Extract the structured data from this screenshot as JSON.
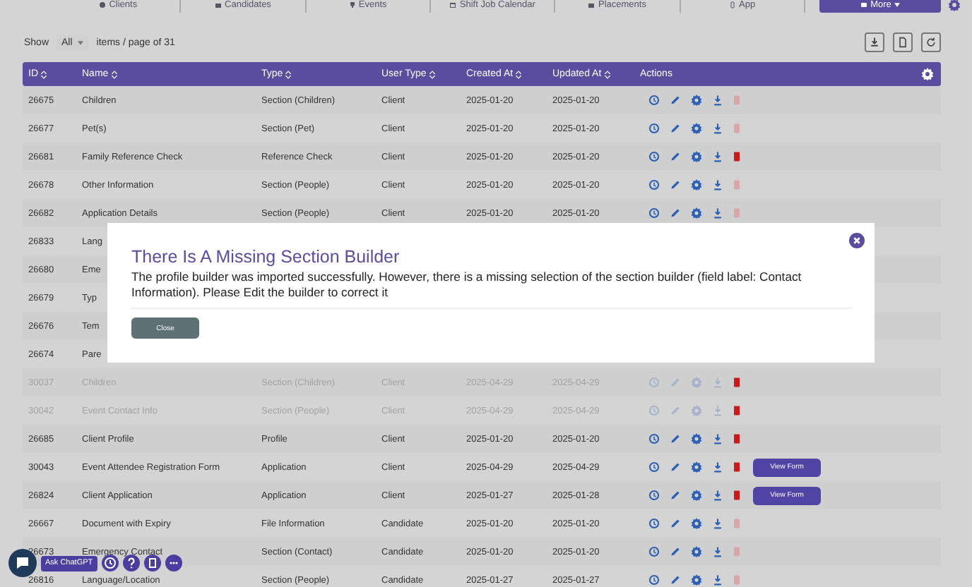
{
  "nav": {
    "tabs": [
      {
        "label": "Clients",
        "selected": false
      },
      {
        "label": "Candidates",
        "selected": false
      },
      {
        "label": "Events",
        "selected": false
      },
      {
        "label": "Shift Job Calendar",
        "selected": false
      },
      {
        "label": "Placements",
        "selected": false
      },
      {
        "label": "App",
        "selected": false
      },
      {
        "label": "More",
        "selected": true
      }
    ]
  },
  "toolbar": {
    "show_label": "Show",
    "page_size": "All",
    "pages_text": "items / page of 31"
  },
  "table": {
    "columns": [
      {
        "label": "ID",
        "sortable": true
      },
      {
        "label": "Name",
        "sortable": true
      },
      {
        "label": "Type",
        "sortable": true
      },
      {
        "label": "User Type",
        "sortable": true
      },
      {
        "label": "Created At",
        "sortable": true
      },
      {
        "label": "Updated At",
        "sortable": true
      },
      {
        "label": "Actions",
        "sortable": false
      }
    ],
    "rows": [
      {
        "id": "26675",
        "name": "Children",
        "type": "Section (Children)",
        "user_type": "Client",
        "created_at": "2025-01-20",
        "updated_at": "2025-01-20",
        "disabled": false,
        "delete_enabled": false
      },
      {
        "id": "26677",
        "name": "Pet(s)",
        "type": "Section (Pet)",
        "user_type": "Client",
        "created_at": "2025-01-20",
        "updated_at": "2025-01-20",
        "disabled": false,
        "delete_enabled": false
      },
      {
        "id": "26681",
        "name": "Family Reference Check",
        "type": "Reference Check",
        "user_type": "Client",
        "created_at": "2025-01-20",
        "updated_at": "2025-01-20",
        "disabled": false,
        "delete_enabled": true
      },
      {
        "id": "26678",
        "name": "Other Information",
        "type": "Section (People)",
        "user_type": "Client",
        "created_at": "2025-01-20",
        "updated_at": "2025-01-20",
        "disabled": false,
        "delete_enabled": false
      },
      {
        "id": "26682",
        "name": "Application Details",
        "type": "Section (People)",
        "user_type": "Client",
        "created_at": "2025-01-20",
        "updated_at": "2025-01-20",
        "disabled": false,
        "delete_enabled": false
      },
      {
        "id": "26833",
        "name": "Lang"
      },
      {
        "id": "26680",
        "name": "Eme"
      },
      {
        "id": "26679",
        "name": "Typ"
      },
      {
        "id": "26676",
        "name": "Tem"
      },
      {
        "id": "26674",
        "name": "Pare"
      },
      {
        "id": "30037",
        "name": "Children",
        "type": "Section (Children)",
        "user_type": "Client",
        "created_at": "2025-04-29",
        "updated_at": "2025-04-29",
        "disabled": true,
        "delete_enabled": true
      },
      {
        "id": "30042",
        "name": "Event Contact Info",
        "type": "Section (People)",
        "user_type": "Client",
        "created_at": "2025-04-29",
        "updated_at": "2025-04-29",
        "disabled": true,
        "delete_enabled": true
      },
      {
        "id": "26685",
        "name": "Client Profile",
        "type": "Profile",
        "user_type": "Client",
        "created_at": "2025-01-20",
        "updated_at": "2025-01-20",
        "disabled": false,
        "delete_enabled": true
      },
      {
        "id": "30043",
        "name": "Event Attendee Registration Form",
        "type": "Application",
        "user_type": "Client",
        "created_at": "2025-04-29",
        "updated_at": "2025-04-29",
        "disabled": false,
        "delete_enabled": true,
        "view_button": "View Form"
      },
      {
        "id": "26824",
        "name": "Client Application",
        "type": "Application",
        "user_type": "Client",
        "created_at": "2025-01-27",
        "updated_at": "2025-01-28",
        "disabled": false,
        "delete_enabled": true,
        "view_button": "View Form"
      },
      {
        "id": "26667",
        "name": "Document with Expiry",
        "type": "File Information",
        "user_type": "Candidate",
        "created_at": "2025-01-20",
        "updated_at": "2025-01-20",
        "disabled": false,
        "delete_enabled": false
      },
      {
        "id": "26673",
        "name": "Emergency Contact",
        "type": "Section (Contact)",
        "user_type": "Candidate",
        "created_at": "2025-01-20",
        "updated_at": "2025-01-20",
        "disabled": false,
        "delete_enabled": false
      },
      {
        "id": "26816",
        "name": "Language/Location",
        "type": "Section (People)",
        "user_type": "Candidate",
        "created_at": "2025-01-27",
        "updated_at": "2025-01-27",
        "disabled": false,
        "delete_enabled": false
      }
    ]
  },
  "modal": {
    "title": "There Is A Missing Section Builder",
    "message": "The profile builder was imported successfully. However, there is a missing selection of the section builder (field label: Contact Information). Please Edit the builder to correct it",
    "close_button": "Close"
  },
  "assistant": {
    "ask_label": "Ask ChatGPT"
  }
}
